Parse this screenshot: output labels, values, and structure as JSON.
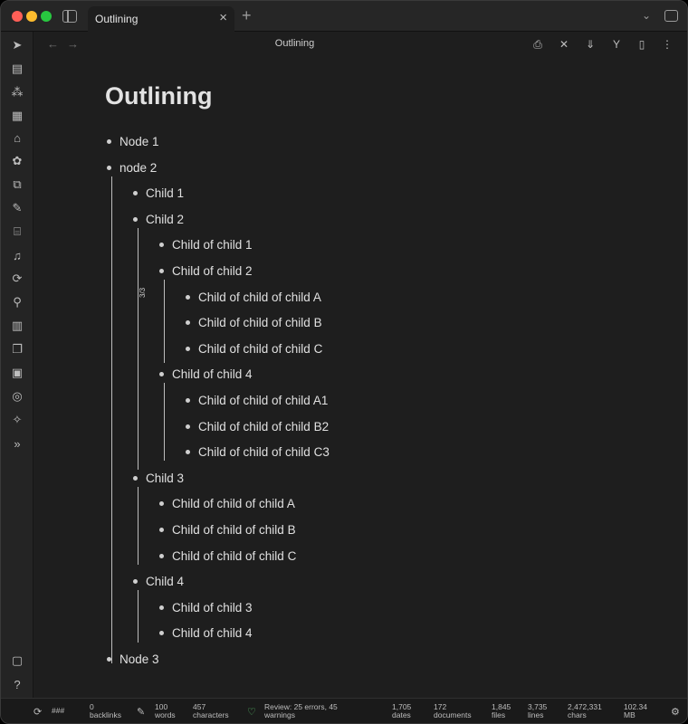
{
  "tab": {
    "title": "Outlining"
  },
  "view": {
    "title": "Outlining"
  },
  "document": {
    "title": "Outlining"
  },
  "outline": [
    {
      "text": "Node 1",
      "level": 0
    },
    {
      "text": "node 2",
      "level": 0
    },
    {
      "text": "Child 1",
      "level": 1
    },
    {
      "text": "Child  2",
      "level": 1
    },
    {
      "text": "Child of child 1",
      "level": 2
    },
    {
      "text": "Child of child 2",
      "level": 2
    },
    {
      "text": "Child of child of child A",
      "level": 3
    },
    {
      "text": "Child of child of child B",
      "level": 3
    },
    {
      "text": "Child of child of child C",
      "level": 3
    },
    {
      "text": "Child of child 4",
      "level": 2
    },
    {
      "text": "Child of child of child A1",
      "level": 3
    },
    {
      "text": "Child of child of child B2",
      "level": 3
    },
    {
      "text": "Child of child of child C3",
      "level": 3
    },
    {
      "text": "Child 3",
      "level": 1
    },
    {
      "text": "Child of child of child A",
      "level": 2
    },
    {
      "text": "Child of child of child B",
      "level": 2
    },
    {
      "text": "Child of child of child C",
      "level": 2
    },
    {
      "text": "Child 4",
      "level": 1
    },
    {
      "text": "Child of child 3",
      "level": 2
    },
    {
      "text": "Child of child 4",
      "level": 2
    },
    {
      "text": "Node 3",
      "level": 0
    }
  ],
  "fold_badge": "3/3",
  "statusbar": {
    "sync": "###",
    "backlinks": {
      "value": "0",
      "label": "backlinks"
    },
    "words": {
      "value": "100",
      "label": "words"
    },
    "characters": {
      "value": "457",
      "label": "characters"
    },
    "lint": {
      "line1": "Review: 25 errors, 45",
      "line2": "warnings"
    },
    "dates": {
      "value": "1,705",
      "label": "dates"
    },
    "documents": {
      "value": "172",
      "label": "documents"
    },
    "files": {
      "value": "1,845",
      "label": "files"
    },
    "lines": {
      "value": "3,735",
      "label": "lines"
    },
    "chars": {
      "value": "2,472,331",
      "label": "chars"
    },
    "size": {
      "value": "102.34",
      "label": "MB"
    }
  }
}
